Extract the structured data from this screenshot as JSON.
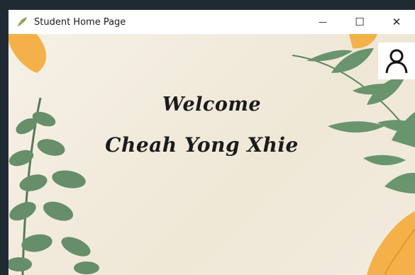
{
  "window": {
    "title": "Student Home Page",
    "app_icon": "feather-logo-icon",
    "controls": {
      "minimize_glyph": "—",
      "maximize_glyph": "☐",
      "close_glyph": "✕"
    }
  },
  "main": {
    "welcome_text": "Welcome",
    "user_name": "Cheah Yong Xhie",
    "profile_icon": "user-profile-icon"
  },
  "colors": {
    "leaf_green": "#5f8a64",
    "leaf_orange": "#f4b14a",
    "background": "#f3eee2"
  }
}
